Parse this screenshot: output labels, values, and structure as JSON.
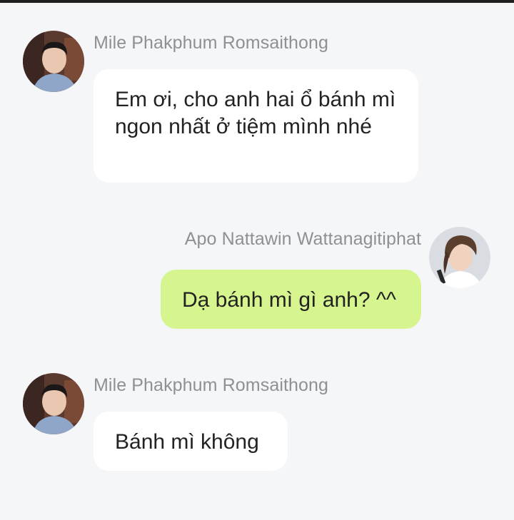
{
  "chat": {
    "messages": [
      {
        "sender": "Mile Phakphum Romsaithong",
        "text": "Em ơi, cho anh hai ổ bánh mì ngon nhất ở tiệm mình nhé",
        "direction": "incoming"
      },
      {
        "sender": "Apo Nattawin Wattanagitiphat",
        "text": "Dạ bánh mì gì anh? ^^",
        "direction": "outgoing"
      },
      {
        "sender": "Mile Phakphum Romsaithong",
        "text": "Bánh mì không",
        "direction": "incoming"
      }
    ]
  },
  "colors": {
    "background": "#f4f6f7",
    "incoming_bubble": "#ffffff",
    "outgoing_bubble": "#d6f58f",
    "sender_name": "#8d9193",
    "message_text": "#222222"
  }
}
